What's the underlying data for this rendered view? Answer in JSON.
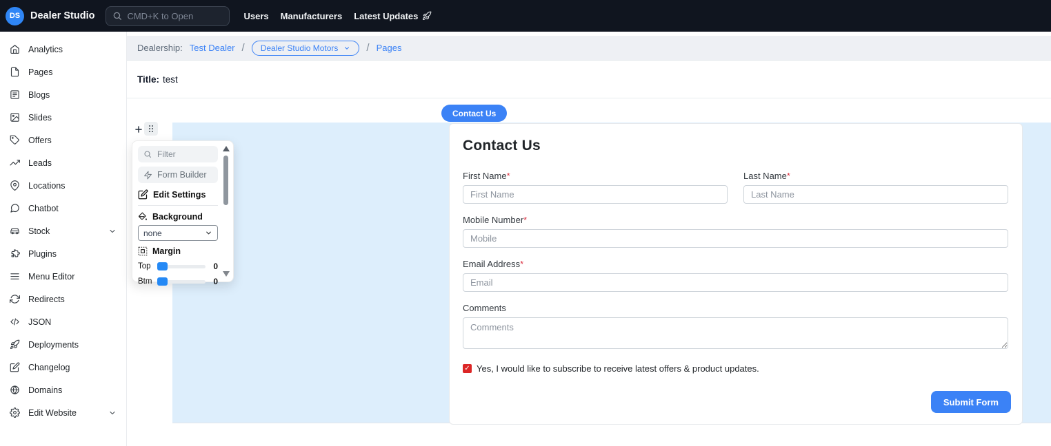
{
  "topnav": {
    "logo": "DS",
    "brand": "Dealer Studio",
    "search_placeholder": "CMD+K to Open",
    "links": [
      {
        "label": "Users"
      },
      {
        "label": "Manufacturers"
      },
      {
        "label": "Latest Updates",
        "icon": "rocket-icon"
      }
    ]
  },
  "sidebar": {
    "items": [
      {
        "icon": "home-icon",
        "label": "Analytics"
      },
      {
        "icon": "file-icon",
        "label": "Pages"
      },
      {
        "icon": "blog-icon",
        "label": "Blogs"
      },
      {
        "icon": "image-icon",
        "label": "Slides"
      },
      {
        "icon": "tag-icon",
        "label": "Offers"
      },
      {
        "icon": "trending-up-icon",
        "label": "Leads"
      },
      {
        "icon": "map-pin-icon",
        "label": "Locations"
      },
      {
        "icon": "chat-icon",
        "label": "Chatbot"
      },
      {
        "icon": "car-icon",
        "label": "Stock",
        "chevron": true
      },
      {
        "icon": "puzzle-icon",
        "label": "Plugins"
      },
      {
        "icon": "menu-icon",
        "label": "Menu Editor"
      },
      {
        "icon": "refresh-icon",
        "label": "Redirects"
      },
      {
        "icon": "code-icon",
        "label": "JSON"
      },
      {
        "icon": "rocket-icon",
        "label": "Deployments"
      },
      {
        "icon": "edit-icon",
        "label": "Changelog"
      },
      {
        "icon": "globe-icon",
        "label": "Domains"
      },
      {
        "icon": "gear-icon",
        "label": "Edit Website",
        "chevron": true
      }
    ]
  },
  "breadcrumb": {
    "prefix": "Dealership:",
    "dealer_link": "Test Dealer",
    "separator": "/",
    "dealer_select": "Dealer Studio Motors",
    "page_link": "Pages"
  },
  "page": {
    "title_label": "Title:",
    "title_value": "test",
    "tab_label": "Contact Us"
  },
  "editor_panel": {
    "filter_placeholder": "Filter",
    "form_builder_label": "Form Builder",
    "edit_settings_label": "Edit Settings",
    "background_label": "Background",
    "background_value": "none",
    "margin_label": "Margin",
    "sliders": [
      {
        "label": "Top",
        "value": "0"
      },
      {
        "label": "Btm",
        "value": "0"
      }
    ]
  },
  "form": {
    "heading": "Contact Us",
    "required_mark": "*",
    "fields": [
      {
        "label": "First Name",
        "required": true,
        "placeholder": "First Name"
      },
      {
        "label": "Last Name",
        "required": true,
        "placeholder": "Last Name"
      },
      {
        "label": "Mobile Number",
        "required": true,
        "placeholder": "Mobile"
      },
      {
        "label": "Email Address",
        "required": true,
        "placeholder": "Email"
      },
      {
        "label": "Comments",
        "required": false,
        "placeholder": "Comments"
      }
    ],
    "checkbox": {
      "checked": true,
      "check_glyph": "✓",
      "label": "Yes, I would like to subscribe to receive latest offers & product updates."
    },
    "submit_label": "Submit Form"
  },
  "colors": {
    "accent_blue": "#3b82f6",
    "canvas_blue": "#ddeefc",
    "navbar_dark": "#10151f",
    "checkbox_red": "#dc2626"
  }
}
